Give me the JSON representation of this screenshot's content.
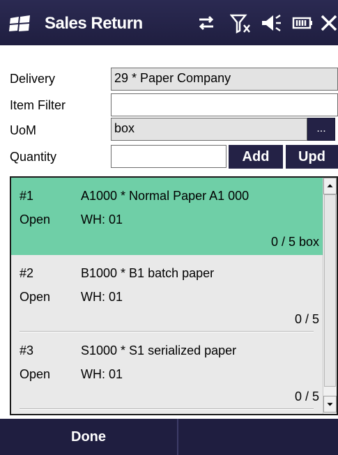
{
  "title_bar": {
    "title": "Sales Return",
    "icons": [
      "windows-flag-icon",
      "sync-arrows-icon",
      "signal-off-icon",
      "speaker-icon",
      "battery-icon",
      "close-icon"
    ]
  },
  "form": {
    "delivery_label": "Delivery",
    "delivery_value": "29 * Paper Company",
    "item_filter_label": "Item Filter",
    "item_filter_value": "",
    "uom_label": "UoM",
    "uom_value": "box",
    "uom_browse_label": "...",
    "quantity_label": "Quantity",
    "quantity_value": "",
    "add_label": "Add",
    "upd_label": "Upd"
  },
  "list": {
    "items": [
      {
        "num": "#1",
        "code": "A1000 * Normal Paper A1 000",
        "status": "Open",
        "wh": "WH: 01",
        "qty": "0 / 5 box",
        "selected": true
      },
      {
        "num": "#2",
        "code": "B1000 * B1 batch paper",
        "status": "Open",
        "wh": "WH: 01",
        "qty": "0 / 5",
        "selected": false
      },
      {
        "num": "#3",
        "code": "S1000 * S1 serialized paper",
        "status": "Open",
        "wh": "WH: 01",
        "qty": "0 / 5",
        "selected": false
      }
    ]
  },
  "bottom_bar": {
    "left_label": "Done",
    "right_label": ""
  },
  "colors": {
    "title_bar_bg": "#1f1e40",
    "selected_row": "#6fcfa7",
    "button_bg": "#242246"
  }
}
